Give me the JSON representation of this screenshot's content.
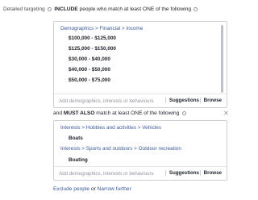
{
  "detailed_targeting": {
    "label": "Detailed targeting",
    "include_prefix": "INCLUDE",
    "include_rest": "people who match at least ONE of the following"
  },
  "include_box": {
    "path": "Demographics > Financial > Income",
    "items": [
      "$100,000 - $125,000",
      "$125,000 - $150,000",
      "$30,000 - $40,000",
      "$40,000 - $50,000",
      "$50,000 - $75,000"
    ],
    "placeholder": "Add demographics, interests or behaviours",
    "suggestions": "Suggestions",
    "browse": "Browse"
  },
  "narrow": {
    "prefix": "and",
    "must_also": "MUST ALSO",
    "rest": "match at least ONE of the following"
  },
  "narrow_box": {
    "groups": [
      {
        "path": "Interests > Hobbies and activities > Vehicles",
        "item": "Boats"
      },
      {
        "path": "Interests > Sports and outdoors > Outdoor recreation",
        "item": "Boating"
      }
    ],
    "placeholder": "Add demographics, interests or behaviours",
    "suggestions": "Suggestions",
    "browse": "Browse"
  },
  "footer": {
    "exclude": "Exclude people",
    "or": "or",
    "narrow_further": "Narrow further"
  }
}
